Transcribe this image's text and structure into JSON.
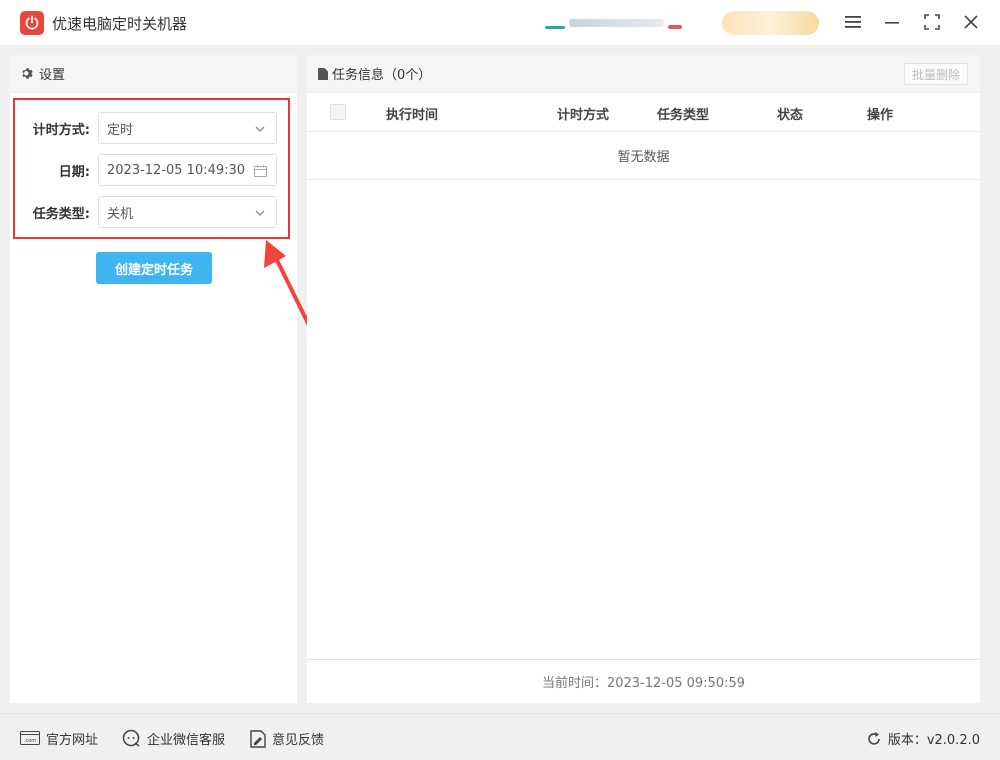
{
  "app": {
    "title": "优速电脑定时关机器"
  },
  "colors": {
    "accent": "#3eb4f0",
    "logo": "#e8463c",
    "highlight": "#e8363c"
  },
  "settings": {
    "header": "设置",
    "fields": {
      "mode": {
        "label": "计时方式:",
        "value": "定时"
      },
      "date": {
        "label": "日期:",
        "value": "2023-12-05 10:49:30"
      },
      "task_type": {
        "label": "任务类型:",
        "value": "关机"
      }
    },
    "create_button": "创建定时任务"
  },
  "tasks": {
    "header": "任务信息（0个）",
    "bulk_delete": "批量删除",
    "columns": [
      "执行时间",
      "计时方式",
      "任务类型",
      "状态",
      "操作"
    ],
    "empty_text": "暂无数据",
    "current_time": "当前时间：2023-12-05 09:50:59"
  },
  "footer": {
    "website": "官方网址",
    "wechat": "企业微信客服",
    "feedback": "意见反馈",
    "version": "版本：v2.0.2.0"
  }
}
